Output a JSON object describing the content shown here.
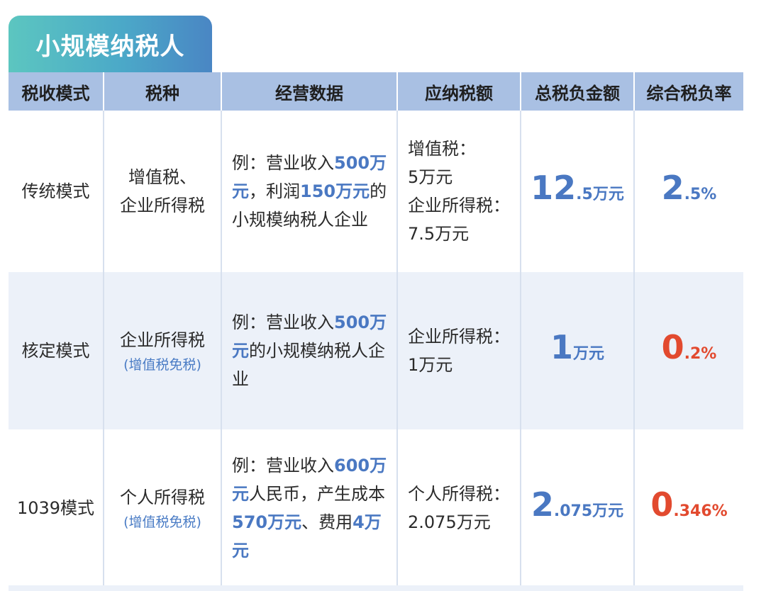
{
  "title": "小规模纳税人",
  "headers": [
    "税收模式",
    "税种",
    "经营数据",
    "应纳税额",
    "总税负金额",
    "综合税负率"
  ],
  "rows": [
    {
      "mode": "传统模式",
      "kind_lines": [
        "增值税、",
        "企业所得税"
      ],
      "kind_note": "",
      "business": [
        {
          "t": "例：营业收入",
          "hl": false
        },
        {
          "t": "500万元",
          "hl": true
        },
        {
          "t": "，利润",
          "hl": false
        },
        {
          "t": "150万元",
          "hl": true
        },
        {
          "t": "的小规模纳税人企业",
          "hl": false
        }
      ],
      "due_lines": [
        "增值税：",
        "5万元",
        "企业所得税：",
        "7.5万元"
      ],
      "total_int": "12",
      "total_dec": ".5万元",
      "total_color": "blue",
      "rate_int": "2",
      "rate_dec": ".5%",
      "rate_color": "blue"
    },
    {
      "mode": "核定模式",
      "kind_lines": [
        "企业所得税"
      ],
      "kind_note": "(增值税免税)",
      "business": [
        {
          "t": "例：营业收入",
          "hl": false
        },
        {
          "t": "500万元",
          "hl": true
        },
        {
          "t": "的小规模纳税人企业",
          "hl": false
        }
      ],
      "due_lines": [
        "企业所得税：",
        "1万元"
      ],
      "total_int": "1",
      "total_dec": "万元",
      "total_color": "blue",
      "rate_int": "0",
      "rate_dec": ".2%",
      "rate_color": "red"
    },
    {
      "mode": "1039模式",
      "kind_lines": [
        "个人所得税"
      ],
      "kind_note": "(增值税免税)",
      "business": [
        {
          "t": "例：营业收入",
          "hl": false
        },
        {
          "t": "600万元",
          "hl": true
        },
        {
          "t": "人民币，产生成本",
          "hl": false
        },
        {
          "t": "570万元",
          "hl": true
        },
        {
          "t": "、费用",
          "hl": false
        },
        {
          "t": "4万元",
          "hl": true
        }
      ],
      "due_lines": [
        "个人所得税：",
        "2.075万元"
      ],
      "total_int": "2",
      "total_dec": ".075万元",
      "total_color": "blue",
      "rate_int": "0",
      "rate_dec": ".346%",
      "rate_color": "red"
    }
  ],
  "colors": {
    "header_bg": "#a9c0e3",
    "title_gradient_start": "#5cc6c0",
    "title_gradient_end": "#4a86c4",
    "highlight_blue": "#4a78c2",
    "highlight_red": "#e24a2f",
    "alt_row_bg": "#ecf1f9"
  }
}
